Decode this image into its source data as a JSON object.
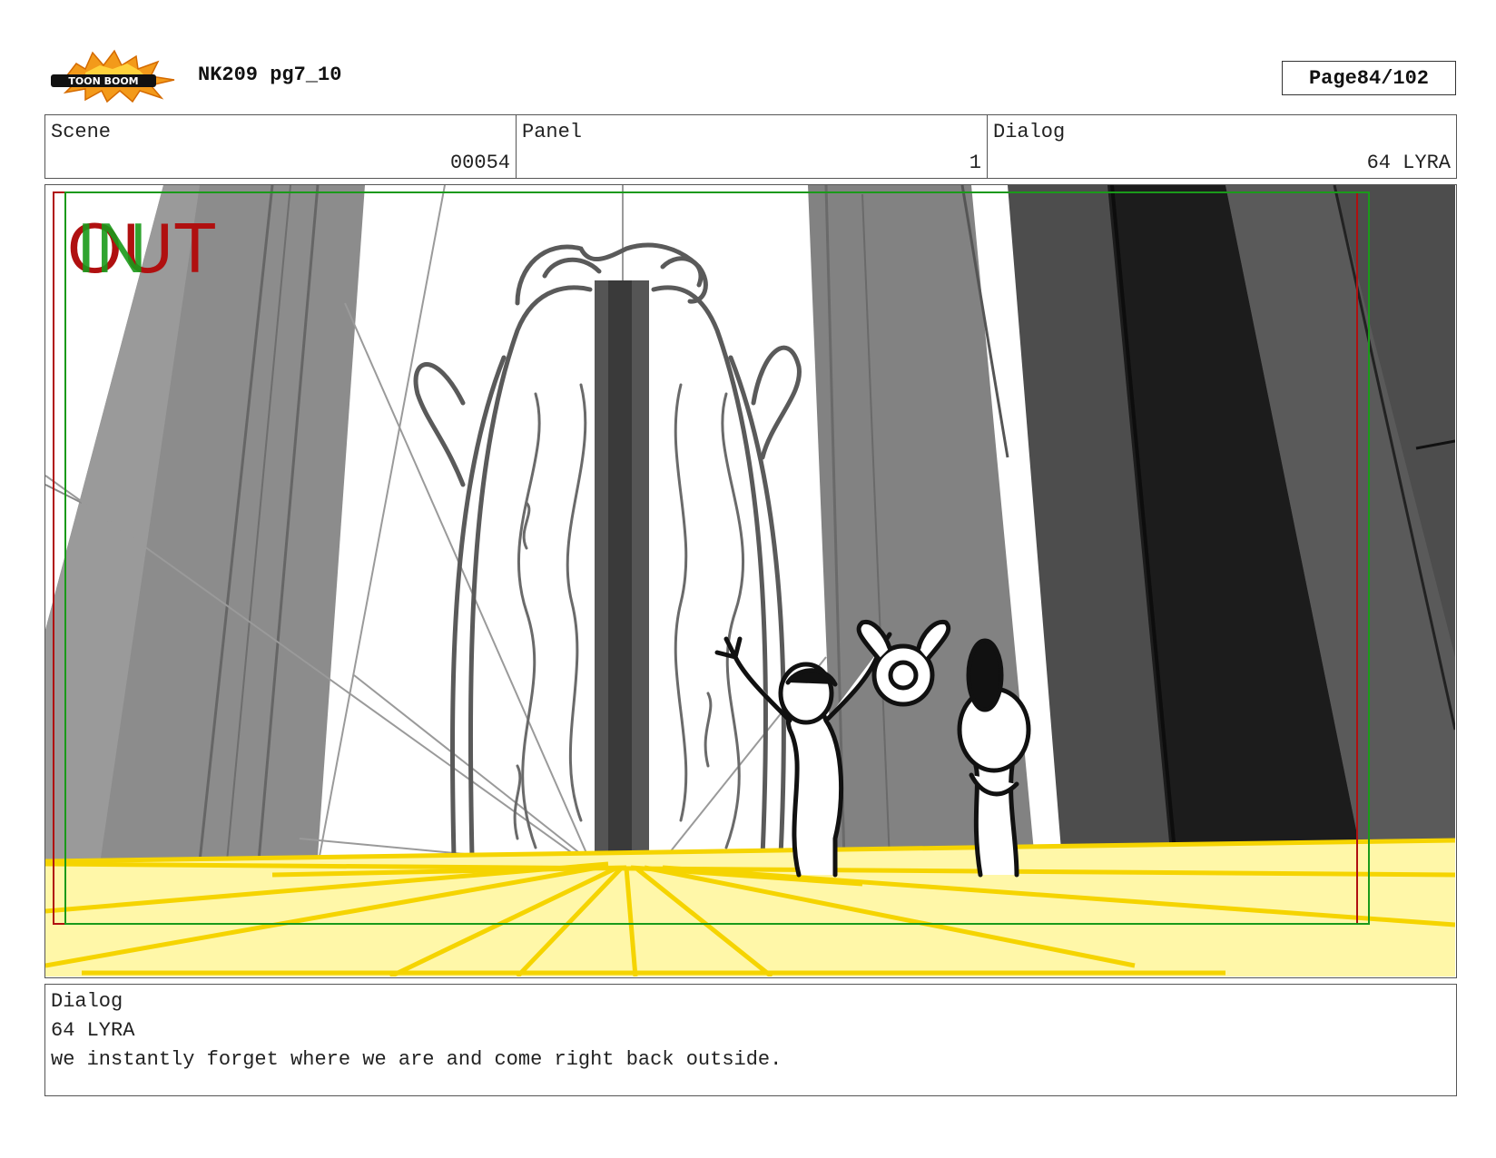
{
  "header": {
    "logo_text": "TOON BOOM",
    "doc_title": "NK209 pg7_10",
    "page_label": "Page",
    "page_number": "84/102"
  },
  "info": {
    "scene_label": "Scene",
    "scene_value": "00054",
    "panel_label": "Panel",
    "panel_value": "1",
    "dialog_label": "Dialog",
    "dialog_value": "64 LYRA"
  },
  "panel": {
    "overlay_in": "IN",
    "overlay_out": "OUT",
    "colors": {
      "in": "#1a9a1a",
      "out": "#b01010",
      "floor_glow": "#fff7a8",
      "floor_lines": "#f5d400"
    }
  },
  "dialog": {
    "label": "Dialog",
    "character": "64 LYRA",
    "line": "we instantly forget where we are and come right back outside."
  }
}
